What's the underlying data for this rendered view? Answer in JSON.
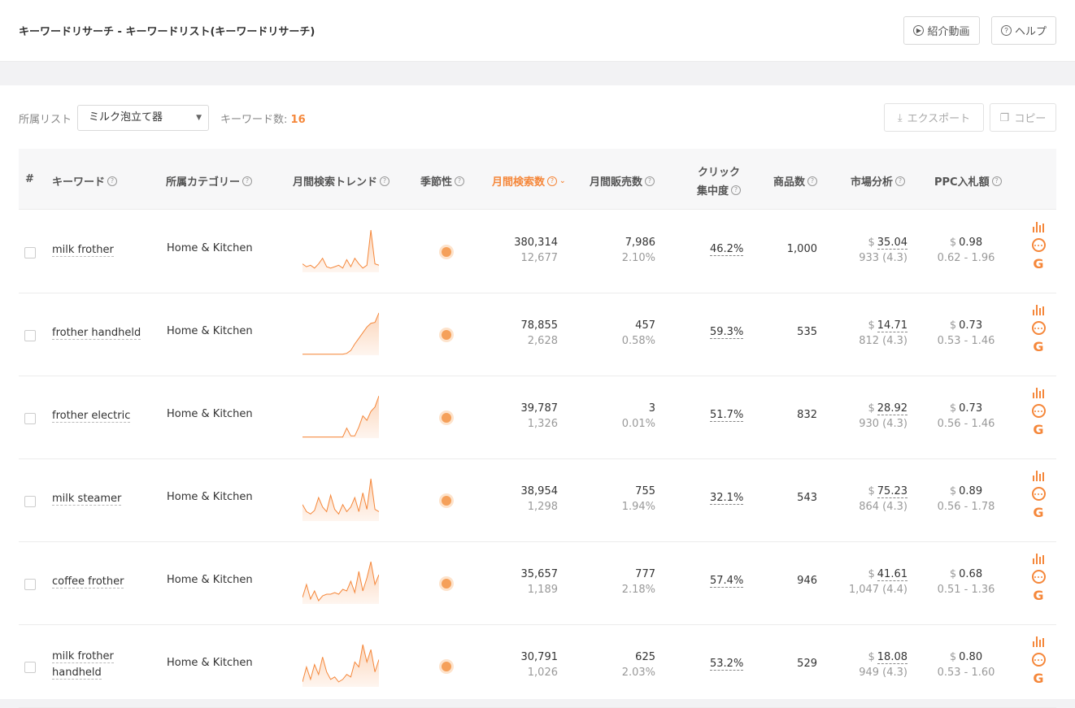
{
  "header": {
    "title": "キーワードリサーチ - キーワードリスト(キーワードリサーチ)",
    "video_label": "紹介動画",
    "help_label": "ヘルプ"
  },
  "filter": {
    "list_label": "所属リスト",
    "list_value": "ミルク泡立て器",
    "count_label": "キーワード数:",
    "count_value": "16",
    "export_label": "エクスポート",
    "copy_label": "コピー"
  },
  "columns": {
    "index": "#",
    "keyword": "キーワード",
    "category": "所属カテゴリー",
    "trend": "月間検索トレンド",
    "seasonality": "季節性",
    "search_volume": "月間検索数",
    "sales": "月間販売数",
    "click_1": "クリック",
    "click_2": "集中度",
    "products": "商品数",
    "market": "市場分析",
    "ppc": "PPC入札額"
  },
  "colors": {
    "accent": "#f5873a",
    "seasonal_dot": "#f5a05a"
  },
  "rows": [
    {
      "keyword": "milk frother",
      "category": "Home & Kitchen",
      "search": "380,314",
      "search_sub": "12,677",
      "sales": "7,986",
      "sales_sub": "2.10%",
      "click": "46.2%",
      "products": "1,000",
      "price": "35.04",
      "reviews": "933 (4.3)",
      "ppc": "0.98",
      "ppc_range": "0.62 - 1.96",
      "trend": [
        6,
        4,
        5,
        3,
        6,
        10,
        4,
        3,
        4,
        5,
        3,
        9,
        4,
        10,
        6,
        3,
        5,
        30,
        6,
        5
      ]
    },
    {
      "keyword": "frother handheld",
      "category": "Home & Kitchen",
      "search": "78,855",
      "search_sub": "2,628",
      "sales": "457",
      "sales_sub": "0.58%",
      "click": "59.3%",
      "products": "535",
      "price": "14.71",
      "reviews": "812 (4.3)",
      "ppc": "0.73",
      "ppc_range": "0.53 - 1.46",
      "trend": [
        1,
        1,
        1,
        1,
        1,
        1,
        1,
        1,
        1,
        1,
        1,
        2,
        5,
        12,
        18,
        24,
        30,
        34,
        35,
        45
      ]
    },
    {
      "keyword": "frother electric",
      "category": "Home & Kitchen",
      "search": "39,787",
      "search_sub": "1,326",
      "sales": "3",
      "sales_sub": "0.01%",
      "click": "51.7%",
      "products": "832",
      "price": "28.92",
      "reviews": "930 (4.3)",
      "ppc": "0.73",
      "ppc_range": "0.56 - 1.46",
      "trend": [
        1,
        1,
        1,
        1,
        1,
        1,
        1,
        1,
        1,
        1,
        1,
        9,
        2,
        2,
        10,
        20,
        16,
        24,
        28,
        38
      ]
    },
    {
      "keyword": "milk steamer",
      "category": "Home & Kitchen",
      "search": "38,954",
      "search_sub": "1,298",
      "sales": "755",
      "sales_sub": "1.94%",
      "click": "32.1%",
      "products": "543",
      "price": "75.23",
      "reviews": "864 (4.3)",
      "ppc": "0.89",
      "ppc_range": "0.56 - 1.78",
      "trend": [
        14,
        8,
        6,
        9,
        20,
        12,
        8,
        22,
        10,
        6,
        14,
        8,
        12,
        20,
        8,
        24,
        10,
        36,
        10,
        8
      ]
    },
    {
      "keyword": "coffee frother",
      "category": "Home & Kitchen",
      "search": "35,657",
      "search_sub": "1,189",
      "sales": "777",
      "sales_sub": "2.18%",
      "click": "57.4%",
      "products": "946",
      "price": "41.61",
      "reviews": "1,047 (4.4)",
      "ppc": "0.68",
      "ppc_range": "0.51 - 1.36",
      "trend": [
        4,
        12,
        3,
        8,
        2,
        5,
        6,
        6,
        7,
        6,
        9,
        8,
        14,
        7,
        20,
        8,
        16,
        26,
        12,
        18
      ]
    },
    {
      "keyword": "milk frother handheld",
      "category": "Home & Kitchen",
      "search": "30,791",
      "search_sub": "1,026",
      "sales": "625",
      "sales_sub": "2.03%",
      "click": "53.2%",
      "products": "529",
      "price": "18.08",
      "reviews": "949 (4.3)",
      "ppc": "0.80",
      "ppc_range": "0.53 - 1.60",
      "trend": [
        4,
        16,
        6,
        18,
        10,
        24,
        12,
        6,
        8,
        4,
        6,
        10,
        8,
        20,
        16,
        34,
        20,
        30,
        12,
        22
      ]
    }
  ]
}
